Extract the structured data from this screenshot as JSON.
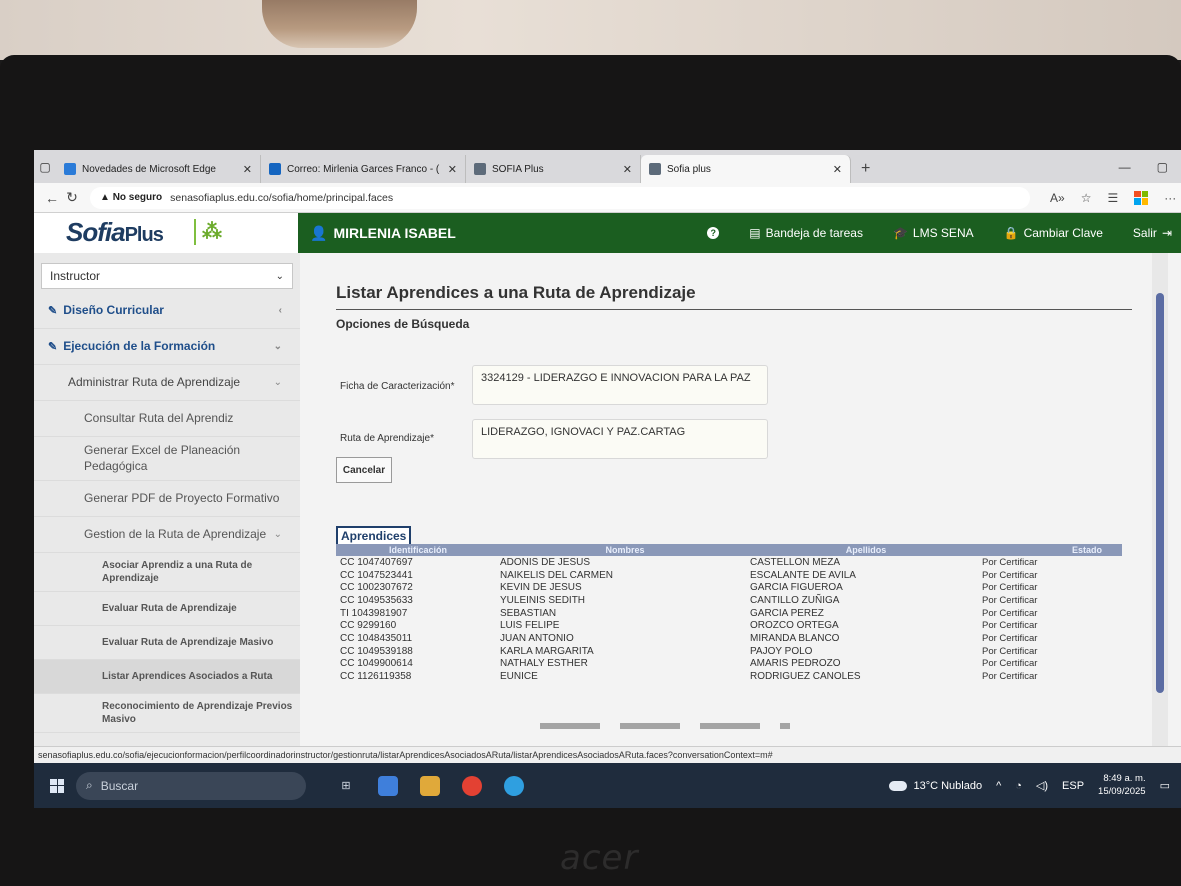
{
  "browser": {
    "tabs": [
      {
        "label": "Novedades de Microsoft Edge",
        "color": "#2b7bd8"
      },
      {
        "label": "Correo: Mirlenia Garces Franco - (",
        "color": "#1565c0"
      },
      {
        "label": "SOFIA Plus",
        "color": "#5d6b7a"
      },
      {
        "label": "Sofia plus",
        "color": "#5d6b7a"
      }
    ],
    "new_tab": "+",
    "security": "No seguro",
    "url": "senasofiaplus.edu.co/sofia/home/principal.faces"
  },
  "header": {
    "logo_text": "Sofia",
    "logo_plus": "Plus",
    "user": "MIRLENIA ISABEL",
    "bandeja": "Bandeja de tareas",
    "lms": "LMS SENA",
    "cambiar": "Cambiar Clave",
    "salir": "Salir"
  },
  "sidebar": {
    "role": "Instructor",
    "items": [
      {
        "label": "Diseño Curricular",
        "level": "top",
        "chev": "‹"
      },
      {
        "label": "Ejecución de la Formación",
        "level": "top",
        "chev": "⌄"
      },
      {
        "label": "Administrar Ruta de Aprendizaje",
        "level": "lvl1",
        "chev": "⌄"
      },
      {
        "label": "Consultar Ruta del Aprendiz",
        "level": "lvl2",
        "chev": ""
      },
      {
        "label": "Generar Excel de Planeación Pedagógica",
        "level": "lvl2",
        "chev": ""
      },
      {
        "label": "Generar PDF de Proyecto Formativo",
        "level": "lvl2",
        "chev": ""
      },
      {
        "label": "Gestion de la Ruta de Aprendizaje",
        "level": "lvl2",
        "chev": "⌄"
      },
      {
        "label": "Asociar Aprendiz a una Ruta de Aprendizaje",
        "level": "lvl3",
        "chev": ""
      },
      {
        "label": "Evaluar Ruta de Aprendizaje",
        "level": "lvl3",
        "chev": ""
      },
      {
        "label": "Evaluar Ruta de Aprendizaje Masivo",
        "level": "lvl3",
        "chev": ""
      },
      {
        "label": "Listar Aprendices Asociados a Ruta",
        "level": "lvl3 active",
        "chev": ""
      },
      {
        "label": "Reconocimiento de Aprendizaje Previos Masivo",
        "level": "lvl3",
        "chev": ""
      }
    ]
  },
  "main": {
    "title": "Listar Aprendices a una Ruta de Aprendizaje",
    "section": "Opciones de Búsqueda",
    "ficha_label": "Ficha de Caracterización*",
    "ficha_value": "3324129 - LIDERAZGO E INNOVACION PARA LA PAZ",
    "ruta_label": "Ruta de Aprendizaje*",
    "ruta_value": "LIDERAZGO, IGNOVACI Y PAZ.CARTAG",
    "cancel": "Cancelar",
    "tab": "Aprendices",
    "columns": [
      "Identificación",
      "Nombres",
      "Apellidos",
      "Estado"
    ],
    "rows": [
      [
        "CC 1047407697",
        "ADONIS DE JESUS",
        "CASTELLON MEZA",
        "Por Certificar"
      ],
      [
        "CC 1047523441",
        "NAIKELIS DEL CARMEN",
        "ESCALANTE DE AVILA",
        "Por Certificar"
      ],
      [
        "CC 1002307672",
        "KEVIN DE JESUS",
        "GARCIA FIGUEROA",
        "Por Certificar"
      ],
      [
        "CC 1049535633",
        "YULEINIS SEDITH",
        "CANTILLO ZUÑIGA",
        "Por Certificar"
      ],
      [
        "TI 1043981907",
        "SEBASTIAN",
        "GARCIA PEREZ",
        "Por Certificar"
      ],
      [
        "CC 9299160",
        "LUIS FELIPE",
        "OROZCO ORTEGA",
        "Por Certificar"
      ],
      [
        "CC 1048435011",
        "JUAN ANTONIO",
        "MIRANDA BLANCO",
        "Por Certificar"
      ],
      [
        "CC 1049539188",
        "KARLA MARGARITA",
        "PAJOY POLO",
        "Por Certificar"
      ],
      [
        "CC 1049900614",
        "NATHALY ESTHER",
        "AMARIS PEDROZO",
        "Por Certificar"
      ],
      [
        "CC 1126119358",
        "EUNICE",
        "RODRIGUEZ CANOLES",
        "Por Certificar"
      ]
    ]
  },
  "status_url": "senasofiaplus.edu.co/sofia/ejecucionformacion/perfilcoordinadorinstructor/gestionruta/listarAprendicesAsociadosARuta/listarAprendicesAsociadosARuta.faces?conversationContext=m#",
  "taskbar": {
    "search": "Buscar",
    "weather": "13°C Nublado",
    "lang": "ESP",
    "time": "8:49 a. m.",
    "date": "15/09/2025"
  },
  "brand": "acer",
  "colors": {
    "green_header": "#1b5e20",
    "table_header": "#8a98b8",
    "link_blue": "#1f4e8a"
  }
}
